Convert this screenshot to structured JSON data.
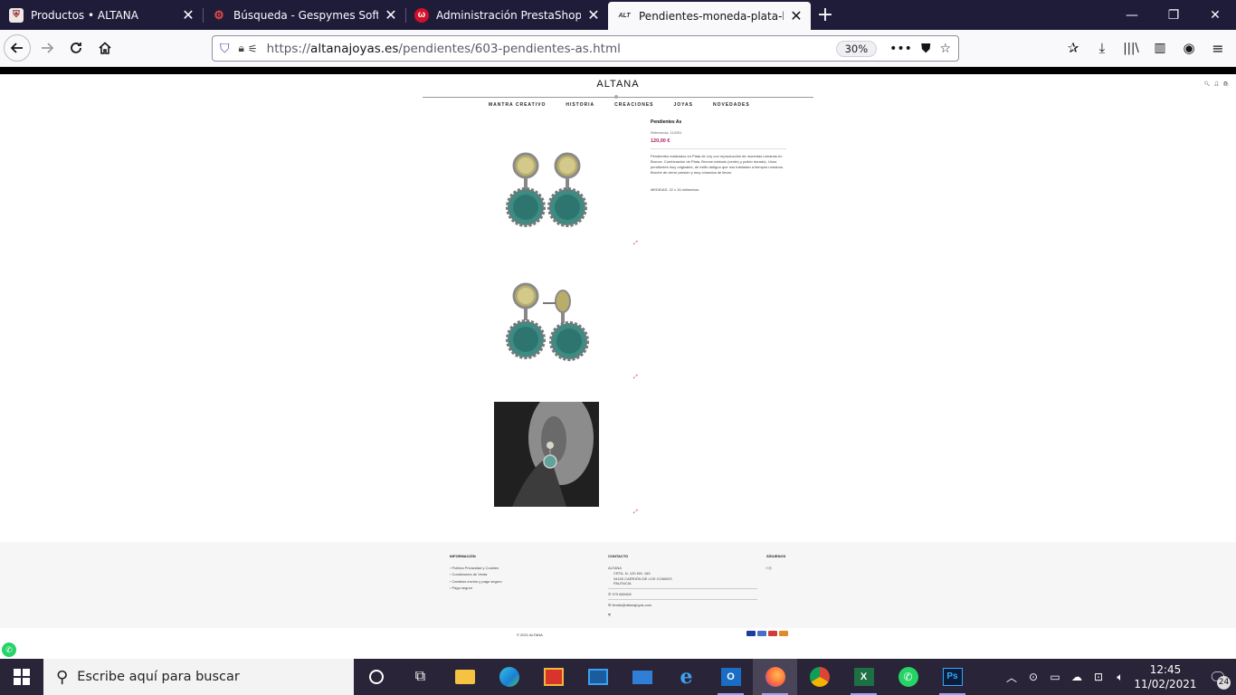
{
  "browser": {
    "tabs": [
      {
        "title": "Productos • ALTANA",
        "favicon": "altana-crest-icon",
        "active": false
      },
      {
        "title": "Búsqueda - Gespymes Software",
        "favicon": "gespymes-icon",
        "active": false
      },
      {
        "title": "Administración PrestaShop – Fa",
        "favicon": "prestashop-icon",
        "active": false
      },
      {
        "title": "Pendientes-moneda-plata-bron",
        "favicon": "altana-logo-icon",
        "active": true
      }
    ],
    "url_prefix": "https://",
    "url_domain": "altanajoyas.es",
    "url_path": "/pendientes/603-pendientes-as.html",
    "zoom": "30%"
  },
  "site": {
    "brand": "ALTANA",
    "menu": [
      "MANTRA CREATIVO",
      "HISTORIA",
      "CREACIONES",
      "JOYAS",
      "NOVEDADES"
    ],
    "accent": "#b01c5c"
  },
  "product": {
    "name": "Pendientes As",
    "reference": "Referencia: 110251",
    "price": "120,00 €",
    "description": "Pendientes realizados en Plata de Ley con reproducción de monedas romanas en Bronce. Combinación de Plata, Bronce oxidado (verde) y pulido dorado). Unos pendientes muy originales, de estilo antiguo que nos trasladan a tiempos romanos. Broche de cierre presión y muy cómodos de llevar.",
    "size": "MEDIDAS:   22 x 15 milímetros."
  },
  "footer": {
    "info_title": "INFORMACIÓN",
    "info_links": [
      "Política Privacidad y Cookies",
      "Condiciones de Venta",
      "Cambios envíos y pago seguro",
      "Pago seguro"
    ],
    "contact_title": "CONTACTO",
    "contact_name": "ALTANA",
    "contact_lines": [
      "CRTA. N. 120 KM. 163",
      "34100 CARRIÓN DE LOS CONDES",
      "PALENCIA"
    ],
    "contact_phone": "979 880408",
    "contact_email": "tienda@altanajoyas.com",
    "follow_title": "SÍGUENOS",
    "copyright": "© 2021 ALTANA"
  },
  "taskbar": {
    "search_placeholder": "Escribe aquí para buscar",
    "time": "12:45",
    "date": "11/02/2021",
    "notifications": "24"
  }
}
